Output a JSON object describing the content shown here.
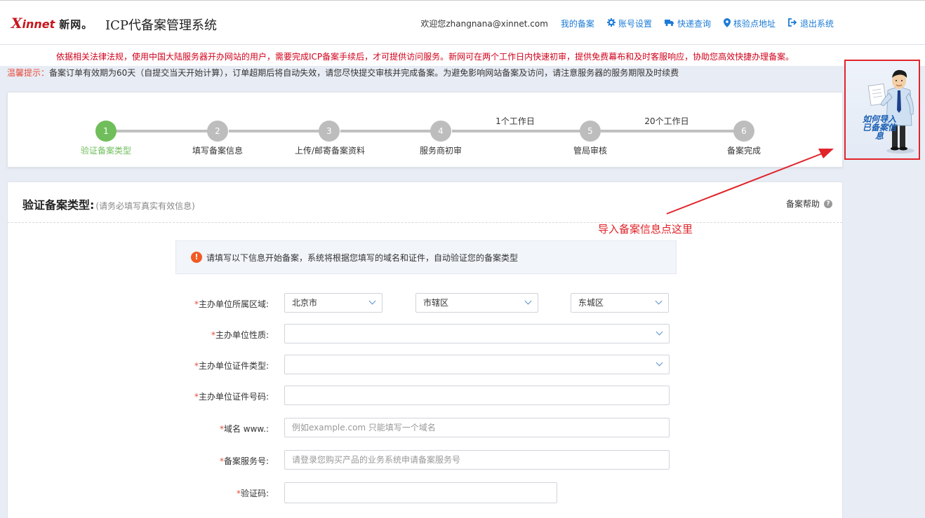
{
  "header": {
    "logo_x": "X",
    "logo_innet": "innet",
    "logo_cn": "新网。",
    "title": "ICP代备案管理系统",
    "welcome": "欢迎您zhangnana@xinnet.com",
    "nav": [
      {
        "label": "我的备案",
        "icon": ""
      },
      {
        "label": "账号设置",
        "icon": "gear-icon"
      },
      {
        "label": "快递查询",
        "icon": "truck-icon"
      },
      {
        "label": "核验点地址",
        "icon": "location-pin-icon"
      },
      {
        "label": "退出系统",
        "icon": "logout-icon"
      }
    ]
  },
  "notice": "依据相关法律法规，使用中国大陆服务器开办网站的用户，需要完成ICP备案手续后，才可提供访问服务。新网可在两个工作日内快速初审，提供免费幕布和及时客服响应，协助您高效快捷办理备案。",
  "tips": {
    "label": "温馨提示：",
    "text": "备案订单有效期为60天（自提交当天开始计算），订单超期后将自动失效，请您尽快提交审核并完成备案。为避免影响网站备案及访问，请注意服务器的服务期限及时续费"
  },
  "steps": [
    {
      "num": "1",
      "label": "验证备案类型",
      "active": true
    },
    {
      "num": "2",
      "label": "填写备案信息",
      "active": false
    },
    {
      "num": "3",
      "label": "上传/邮寄备案资料",
      "active": false
    },
    {
      "num": "4",
      "label": "服务商初审",
      "active": false
    },
    {
      "num": "5",
      "label": "管局审核",
      "active": false
    },
    {
      "num": "6",
      "label": "备案完成",
      "active": false
    }
  ],
  "step_durations": [
    "1个工作日",
    "20个工作日"
  ],
  "form": {
    "title": "验证备案类型:",
    "subtitle": "(请务必填写真实有效信息)",
    "help": "备案帮助",
    "alert": "请填写以下信息开始备案，系统将根据您填写的域名和证件，自动验证您的备案类型",
    "fields": {
      "region": {
        "label": "主办单位所属区域:",
        "province": "北京市",
        "city": "市辖区",
        "district": "东城区"
      },
      "nature": {
        "label": "主办单位性质:",
        "value": ""
      },
      "cert_type": {
        "label": "主办单位证件类型:",
        "value": ""
      },
      "cert_no": {
        "label": "主办单位证件号码:",
        "value": ""
      },
      "domain": {
        "label": "域名 www.:",
        "placeholder": "例如example.com 只能填写一个域名"
      },
      "service_no": {
        "label": "备案服务号:",
        "placeholder": "请登录您购买产品的业务系统申请备案服务号"
      },
      "captcha": {
        "label": "验证码:",
        "value": ""
      }
    },
    "required_mark": "*"
  },
  "side_helper": {
    "text": "如何导入已备案信息"
  },
  "annotation": "导入备案信息点这里",
  "colors": {
    "brand_red": "#c8161d",
    "link_blue": "#1c7bd6",
    "step_active": "#6fbe5b",
    "annotation_red": "#e0242a"
  }
}
